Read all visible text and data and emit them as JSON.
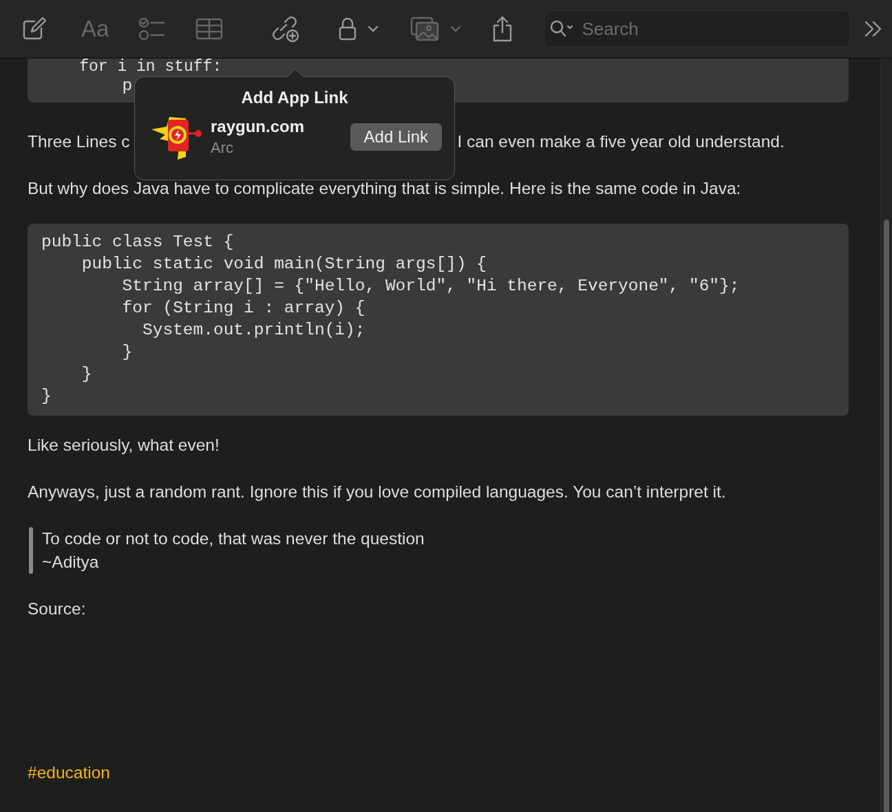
{
  "toolbar": {
    "format_label": "Aa",
    "search": {
      "placeholder": "Search"
    }
  },
  "note": {
    "blocks": [
      {
        "kind": "code",
        "lines": [
          "    for i in stuff:",
          "        p"
        ]
      },
      {
        "kind": "split",
        "parts": [
          "Three Lines c",
          "I can even make a five year old understand."
        ]
      },
      {
        "kind": "paragraph",
        "text": "But why does Java have to complicate everything that is simple. Here is the same code in Java:"
      },
      {
        "kind": "code",
        "lines": [
          "public class Test {",
          "    public static void main(String args[]) {",
          "        String array[] = {\"Hello, World\", \"Hi there, Everyone\", \"6\"};",
          "        for (String i : array) {",
          "          System.out.println(i);",
          "        }",
          "    }",
          "}"
        ]
      },
      {
        "kind": "paragraph",
        "text": "Like seriously, what even!"
      },
      {
        "kind": "paragraph",
        "text": "Anyways, just a random rant. Ignore this if you love compiled languages. You can’t interpret it."
      },
      {
        "kind": "quote",
        "lines": [
          "To code or not to code, that was never the question",
          "~Aditya"
        ]
      },
      {
        "kind": "paragraph",
        "text": "Source:"
      },
      {
        "kind": "tag",
        "text": "#education"
      }
    ]
  },
  "popover": {
    "title": "Add App Link",
    "app_name": "raygun.com",
    "app_source": "Arc",
    "button": "Add Link"
  }
}
